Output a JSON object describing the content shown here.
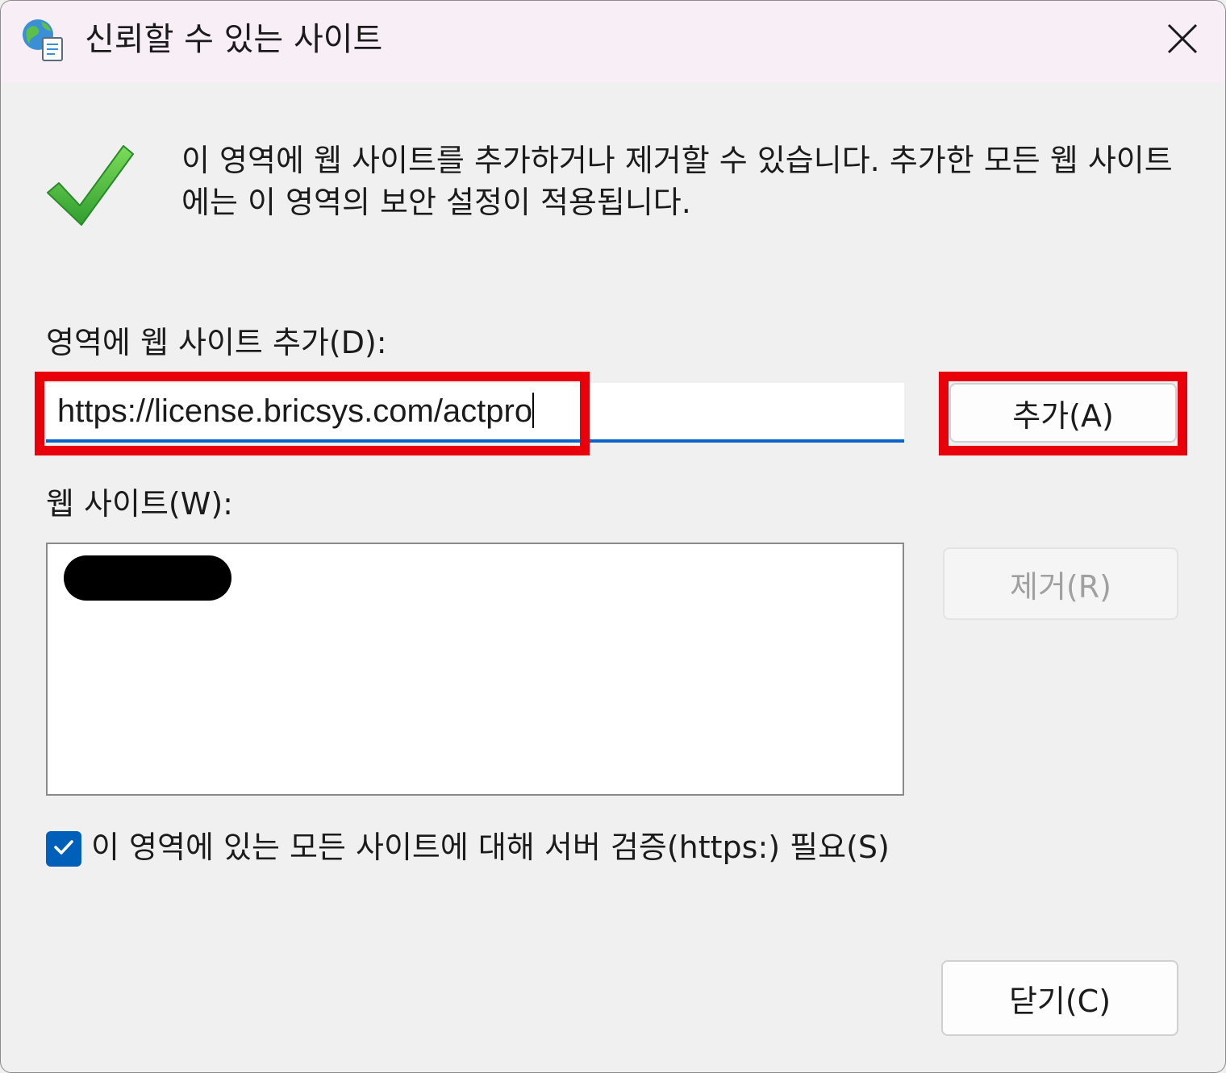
{
  "window": {
    "title": "신뢰할 수 있는 사이트",
    "icons": {
      "app": "globe-sites-icon",
      "close": "close-icon",
      "status": "checkmark-icon"
    }
  },
  "description": "이 영역에 웹 사이트를 추가하거나 제거할 수 있습니다. 추가한 모든 웹 사이트에는 이 영역의 보안 설정이 적용됩니다.",
  "add_site": {
    "label": "영역에 웹 사이트 추가(D):",
    "value": "https://license.bricsys.com/actpro",
    "add_button": "추가(A)"
  },
  "sites": {
    "label": "웹 사이트(W):",
    "items": [
      {
        "redacted": true
      }
    ],
    "remove_button": "제거(R)"
  },
  "require_https": {
    "checked": true,
    "label": "이 영역에 있는 모든 사이트에 대해 서버 검증(https:) 필요(S)"
  },
  "close_button": "닫기(C)",
  "colors": {
    "accent": "#005fb8",
    "input_underline": "#0a64c8",
    "annotation_box": "#e8000b",
    "titlebar": "#f7eef6",
    "check_green": "#3fb53f"
  }
}
